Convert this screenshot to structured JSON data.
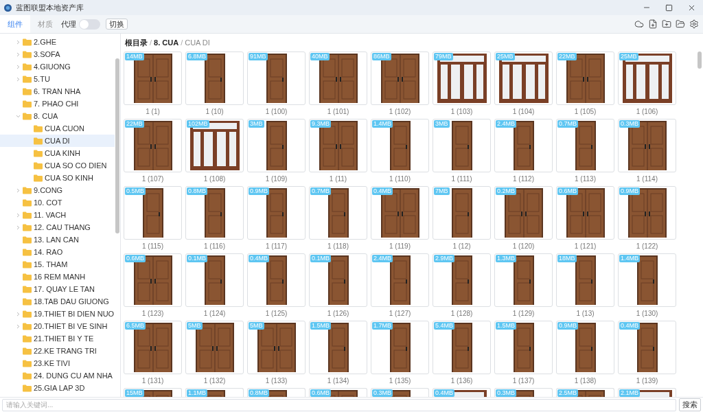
{
  "window": {
    "title": "蓝图联盟本地资产库"
  },
  "toolbar": {
    "tabs": [
      {
        "label": "组件",
        "selected": true
      },
      {
        "label": "材质",
        "selected": false
      }
    ],
    "proxy": {
      "label": "代理",
      "on": false
    },
    "switch_button": "切换"
  },
  "sidebar": {
    "items": [
      {
        "label": "2.GHE",
        "expanded": false,
        "selected": false
      },
      {
        "label": "3.SOFA",
        "expanded": false,
        "selected": false
      },
      {
        "label": "4.GIUONG",
        "expanded": false,
        "selected": false
      },
      {
        "label": "5.TU",
        "expanded": false,
        "selected": false
      },
      {
        "label": "6. TRAN NHA",
        "selected": false
      },
      {
        "label": "7. PHAO CHI",
        "selected": false
      },
      {
        "label": "8. CUA",
        "expanded": true,
        "selected": false,
        "children": [
          {
            "label": "CUA CUON",
            "selected": false
          },
          {
            "label": "CUA DI",
            "selected": true
          },
          {
            "label": "CUA KINH",
            "selected": false
          },
          {
            "label": "CUA SO CO DIEN",
            "selected": false
          },
          {
            "label": "CUA SO KINH",
            "selected": false
          }
        ]
      },
      {
        "label": "9.CONG",
        "expanded": false,
        "selected": false
      },
      {
        "label": "10. COT",
        "selected": false
      },
      {
        "label": "11. VACH",
        "expanded": false,
        "selected": false
      },
      {
        "label": "12. CAU THANG",
        "expanded": false,
        "selected": false
      },
      {
        "label": "13. LAN CAN",
        "selected": false
      },
      {
        "label": "14. RAO",
        "selected": false
      },
      {
        "label": "15. THAM",
        "selected": false
      },
      {
        "label": "16 REM MANH",
        "selected": false
      },
      {
        "label": "17. QUAY LE TAN",
        "selected": false
      },
      {
        "label": "18.TAB DAU GIUONG",
        "selected": false
      },
      {
        "label": "19.THIET BI DIEN NUO",
        "expanded": false,
        "selected": false
      },
      {
        "label": "20.THIET BI VE SINH",
        "expanded": false,
        "selected": false
      },
      {
        "label": "21.THIET BI Y TE",
        "selected": false
      },
      {
        "label": "22.KE TRANG TRI",
        "selected": false
      },
      {
        "label": "23.KE TIVI",
        "selected": false
      },
      {
        "label": "24. DUNG CU AM NHA",
        "selected": false
      },
      {
        "label": "25.GIA LAP 3D",
        "selected": false
      }
    ]
  },
  "breadcrumb": {
    "separator": "/",
    "items": [
      "根目录",
      "8. CUA",
      "CUA DI"
    ]
  },
  "assets": [
    {
      "size": "14MB",
      "label": "1 (1)",
      "kind": "double"
    },
    {
      "size": "6.8MB",
      "label": "1 (10)",
      "kind": "single"
    },
    {
      "size": "91MB",
      "label": "1 (100)",
      "kind": "single"
    },
    {
      "size": "40MB",
      "label": "1 (101)",
      "kind": "double"
    },
    {
      "size": "86MB",
      "label": "1 (102)",
      "kind": "double"
    },
    {
      "size": "79MB",
      "label": "1 (103)",
      "kind": "wide"
    },
    {
      "size": "25MB",
      "label": "1 (104)",
      "kind": "wide"
    },
    {
      "size": "22MB",
      "label": "1 (105)",
      "kind": "double"
    },
    {
      "size": "25MB",
      "label": "1 (106)",
      "kind": "wide"
    },
    {
      "size": "22MB",
      "label": "1 (107)",
      "kind": "double"
    },
    {
      "size": "102MB",
      "label": "1 (108)",
      "kind": "wide"
    },
    {
      "size": "3MB",
      "label": "1 (109)",
      "kind": "single"
    },
    {
      "size": "9.3MB",
      "label": "1 (11)",
      "kind": "double"
    },
    {
      "size": "1.4MB",
      "label": "1 (110)",
      "kind": "single"
    },
    {
      "size": "3MB",
      "label": "1 (111)",
      "kind": "single"
    },
    {
      "size": "2.4MB",
      "label": "1 (112)",
      "kind": "single"
    },
    {
      "size": "0.7MB",
      "label": "1 (113)",
      "kind": "single"
    },
    {
      "size": "0.3MB",
      "label": "1 (114)",
      "kind": "double"
    },
    {
      "size": "0.5MB",
      "label": "1 (115)",
      "kind": "single"
    },
    {
      "size": "0.8MB",
      "label": "1 (116)",
      "kind": "single"
    },
    {
      "size": "0.9MB",
      "label": "1 (117)",
      "kind": "single"
    },
    {
      "size": "0.7MB",
      "label": "1 (118)",
      "kind": "single"
    },
    {
      "size": "0.4MB",
      "label": "1 (119)",
      "kind": "double"
    },
    {
      "size": "7MB",
      "label": "1 (12)",
      "kind": "single"
    },
    {
      "size": "0.2MB",
      "label": "1 (120)",
      "kind": "double"
    },
    {
      "size": "0.6MB",
      "label": "1 (121)",
      "kind": "double"
    },
    {
      "size": "0.9MB",
      "label": "1 (122)",
      "kind": "double"
    },
    {
      "size": "0.6MB",
      "label": "1 (123)",
      "kind": "double"
    },
    {
      "size": "0.1MB",
      "label": "1 (124)",
      "kind": "single"
    },
    {
      "size": "0.4MB",
      "label": "1 (125)",
      "kind": "single"
    },
    {
      "size": "0.1MB",
      "label": "1 (126)",
      "kind": "single"
    },
    {
      "size": "2.4MB",
      "label": "1 (127)",
      "kind": "single"
    },
    {
      "size": "2.9MB",
      "label": "1 (128)",
      "kind": "single"
    },
    {
      "size": "1.3MB",
      "label": "1 (129)",
      "kind": "single"
    },
    {
      "size": "18MB",
      "label": "1 (13)",
      "kind": "single"
    },
    {
      "size": "1.4MB",
      "label": "1 (130)",
      "kind": "single"
    },
    {
      "size": "6.5MB",
      "label": "1 (131)",
      "kind": "double"
    },
    {
      "size": "5MB",
      "label": "1 (132)",
      "kind": "double"
    },
    {
      "size": "5MB",
      "label": "1 (133)",
      "kind": "double"
    },
    {
      "size": "1.5MB",
      "label": "1 (134)",
      "kind": "single"
    },
    {
      "size": "1.7MB",
      "label": "1 (135)",
      "kind": "single"
    },
    {
      "size": "5.4MB",
      "label": "1 (136)",
      "kind": "single"
    },
    {
      "size": "1.5MB",
      "label": "1 (137)",
      "kind": "single"
    },
    {
      "size": "0.9MB",
      "label": "1 (138)",
      "kind": "single"
    },
    {
      "size": "0.4MB",
      "label": "1 (139)",
      "kind": "single"
    },
    {
      "size": "15MB",
      "kind": "double"
    },
    {
      "size": "1.1MB",
      "kind": "single"
    },
    {
      "size": "0.8MB",
      "kind": "single"
    },
    {
      "size": "0.6MB",
      "kind": "double"
    },
    {
      "size": "0.3MB",
      "kind": "single"
    },
    {
      "size": "0.4MB",
      "kind": "wide"
    },
    {
      "size": "0.3MB",
      "kind": "single"
    },
    {
      "size": "2.5MB",
      "kind": "double"
    },
    {
      "size": "2.1MB",
      "kind": "wide"
    }
  ],
  "search": {
    "placeholder": "请输入关键词...",
    "button": "搜索"
  }
}
